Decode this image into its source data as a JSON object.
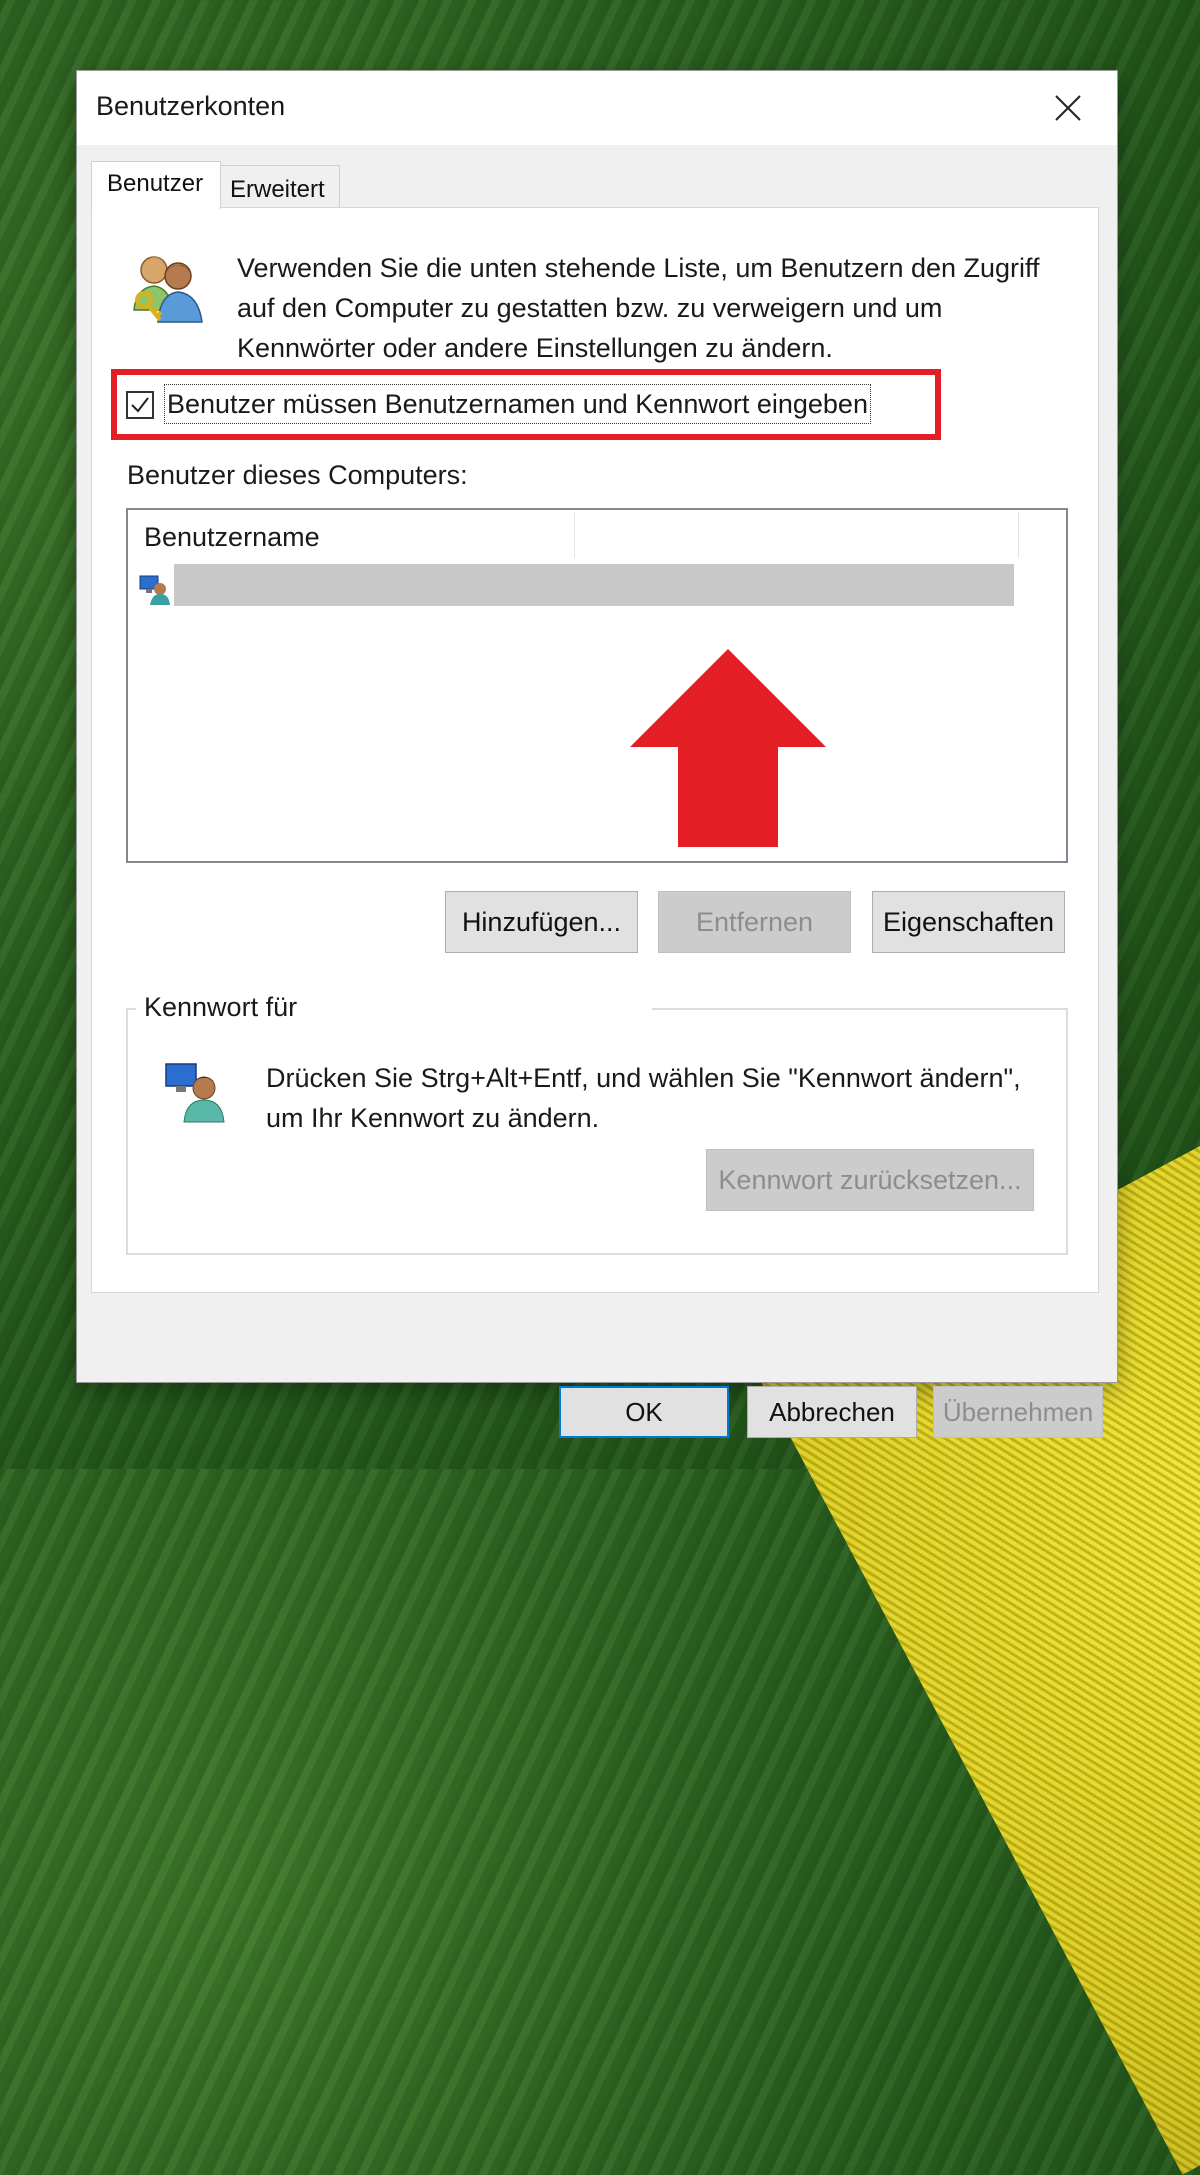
{
  "window": {
    "title": "Benutzerkonten",
    "close_label": "✕"
  },
  "tabs": [
    {
      "label": "Benutzer",
      "active": true
    },
    {
      "label": "Erweitert",
      "active": false
    }
  ],
  "intro": {
    "text": "Verwenden Sie die unten stehende Liste, um Benutzern den Zugriff auf den Computer zu gestatten bzw. zu verweigern und um Kennwörter oder andere Einstellungen zu ändern.",
    "icon": "users-key-icon"
  },
  "require_login": {
    "label": "Benutzer müssen Benutzernamen und Kennwort eingeben",
    "checked": true,
    "highlight_color": "#e31e24"
  },
  "users_section": {
    "label": "Benutzer dieses Computers:",
    "column_header": "Benutzername",
    "rows": [
      {
        "icon": "computer-user-icon",
        "name_redacted": true
      }
    ]
  },
  "buttons": {
    "add": "Hinzufügen...",
    "remove": "Entfernen",
    "properties": "Eigenschaften"
  },
  "password_group": {
    "title": "Kennwort für",
    "text": "Drücken Sie Strg+Alt+Entf, und wählen Sie \"Kennwort ändern\", um Ihr Kennwort zu ändern.",
    "icon": "computer-user-icon",
    "reset_button": "Kennwort zurücksetzen..."
  },
  "footer": {
    "ok": "OK",
    "cancel": "Abbrechen",
    "apply": "Übernehmen"
  },
  "annotation": {
    "arrow_color": "#e31e24",
    "arrow_direction": "up"
  }
}
